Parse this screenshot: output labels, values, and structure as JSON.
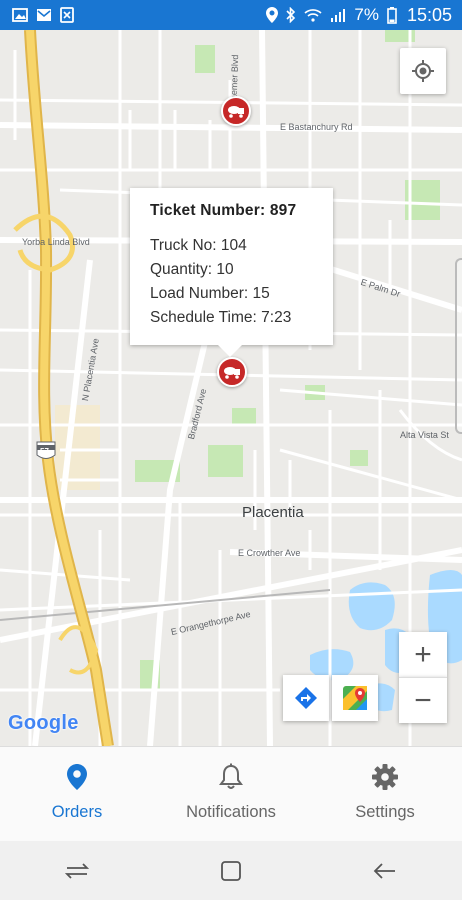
{
  "status_bar": {
    "battery_text": "7%",
    "time": "15:05",
    "color": "#1976d2"
  },
  "map": {
    "street_labels": {
      "yorba_linda": "Yorba Linda Blvd",
      "bastanchury": "E Bastanchury Rd",
      "kraemer": "N Kraemer Blvd",
      "palm": "E Palm Dr",
      "alta_vista": "Alta Vista St",
      "placentia_ave": "N Placentia Ave",
      "bradford": "Bradford Ave",
      "crowther": "E Crowther Ave",
      "orangethorpe": "E Orangethorpe Ave"
    },
    "city_label": "Placentia",
    "highway_shield": "57",
    "attribution": "Google",
    "info_window": {
      "title": "Ticket Number: 897",
      "truck_no": "Truck No: 104",
      "quantity": "Quantity: 10",
      "load_number": "Load Number: 15",
      "schedule_time": "Schedule Time: 7:23"
    },
    "zoom_in_label": "+",
    "zoom_out_label": "−",
    "marker_color": "#c62828"
  },
  "bottom_nav": {
    "tabs": [
      {
        "label": "Orders",
        "icon": "location-pin-icon",
        "active": true
      },
      {
        "label": "Notifications",
        "icon": "bell-icon",
        "active": false
      },
      {
        "label": "Settings",
        "icon": "gear-icon",
        "active": false
      }
    ],
    "accent": "#1976d2"
  }
}
